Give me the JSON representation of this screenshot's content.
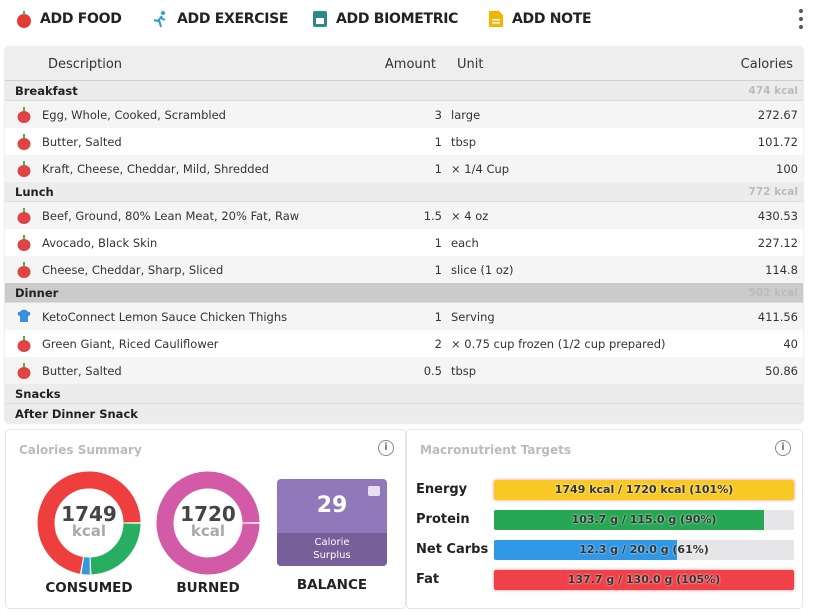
{
  "toolbar": {
    "add_food": "ADD FOOD",
    "add_exercise": "ADD EXERCISE",
    "add_biometric": "ADD BIOMETRIC",
    "add_note": "ADD NOTE"
  },
  "table": {
    "headers": {
      "description": "Description",
      "amount": "Amount",
      "unit": "Unit",
      "calories": "Calories"
    },
    "sections": [
      {
        "name": "Breakfast",
        "kcal": "474 kcal",
        "items": [
          {
            "icon": "apple-icon",
            "description": "Egg, Whole, Cooked, Scrambled",
            "amount": "3",
            "unit": "large",
            "calories": "272.67"
          },
          {
            "icon": "apple-icon",
            "description": "Butter, Salted",
            "amount": "1",
            "unit": "tbsp",
            "calories": "101.72"
          },
          {
            "icon": "apple-icon",
            "description": "Kraft, Cheese, Cheddar, Mild, Shredded",
            "amount": "1",
            "unit": "× 1/4 Cup",
            "calories": "100"
          }
        ]
      },
      {
        "name": "Lunch",
        "kcal": "772 kcal",
        "items": [
          {
            "icon": "apple-icon",
            "description": "Beef, Ground, 80% Lean Meat, 20% Fat, Raw",
            "amount": "1.5",
            "unit": "× 4 oz",
            "calories": "430.53"
          },
          {
            "icon": "apple-icon",
            "description": "Avocado, Black Skin",
            "amount": "1",
            "unit": "each",
            "calories": "227.12"
          },
          {
            "icon": "apple-icon",
            "description": "Cheese, Cheddar, Sharp, Sliced",
            "amount": "1",
            "unit": "slice (1 oz)",
            "calories": "114.8"
          }
        ]
      },
      {
        "name": "Dinner",
        "kcal": "502 kcal",
        "selected": true,
        "items": [
          {
            "icon": "chef-hat-icon",
            "description": "KetoConnect Lemon Sauce Chicken Thighs",
            "amount": "1",
            "unit": "Serving",
            "calories": "411.56"
          },
          {
            "icon": "apple-icon",
            "description": "Green Giant, Riced Cauliflower",
            "amount": "2",
            "unit": "× 0.75 cup frozen (1/2 cup prepared)",
            "calories": "40"
          },
          {
            "icon": "apple-icon",
            "description": "Butter, Salted",
            "amount": "0.5",
            "unit": "tbsp",
            "calories": "50.86"
          }
        ]
      },
      {
        "name": "Snacks",
        "kcal": "",
        "items": []
      },
      {
        "name": "After Dinner Snack",
        "kcal": "",
        "items": []
      }
    ]
  },
  "calories_summary": {
    "title": "Calories Summary",
    "consumed": {
      "value": "1749",
      "unit": "kcal",
      "label": "CONSUMED",
      "segments": [
        {
          "name": "protein",
          "fraction": 0.24,
          "color": "#27ae60"
        },
        {
          "name": "carbs",
          "fraction": 0.03,
          "color": "#3498db"
        },
        {
          "name": "fat",
          "fraction": 0.71,
          "color": "#ee3e3e"
        }
      ]
    },
    "burned": {
      "value": "1720",
      "unit": "kcal",
      "label": "BURNED",
      "color": "#d25aa7"
    },
    "balance": {
      "value": "29",
      "sub1": "Calorie",
      "sub2": "Surplus",
      "label": "BALANCE"
    }
  },
  "macro_targets": {
    "title": "Macronutrient Targets",
    "rows": [
      {
        "label": "Energy",
        "text": "1749 kcal / 1720 kcal (101%)",
        "percent": 101,
        "color": "#f8c924"
      },
      {
        "label": "Protein",
        "text": "103.7 g / 115.0 g (90%)",
        "percent": 90,
        "color": "#27a653"
      },
      {
        "label": "Net Carbs",
        "text": "12.3 g / 20.0 g (61%)",
        "percent": 61,
        "color": "#2f97e6"
      },
      {
        "label": "Fat",
        "text": "137.7 g / 130.0 g (105%)",
        "percent": 105,
        "color": "#f04148"
      }
    ]
  }
}
